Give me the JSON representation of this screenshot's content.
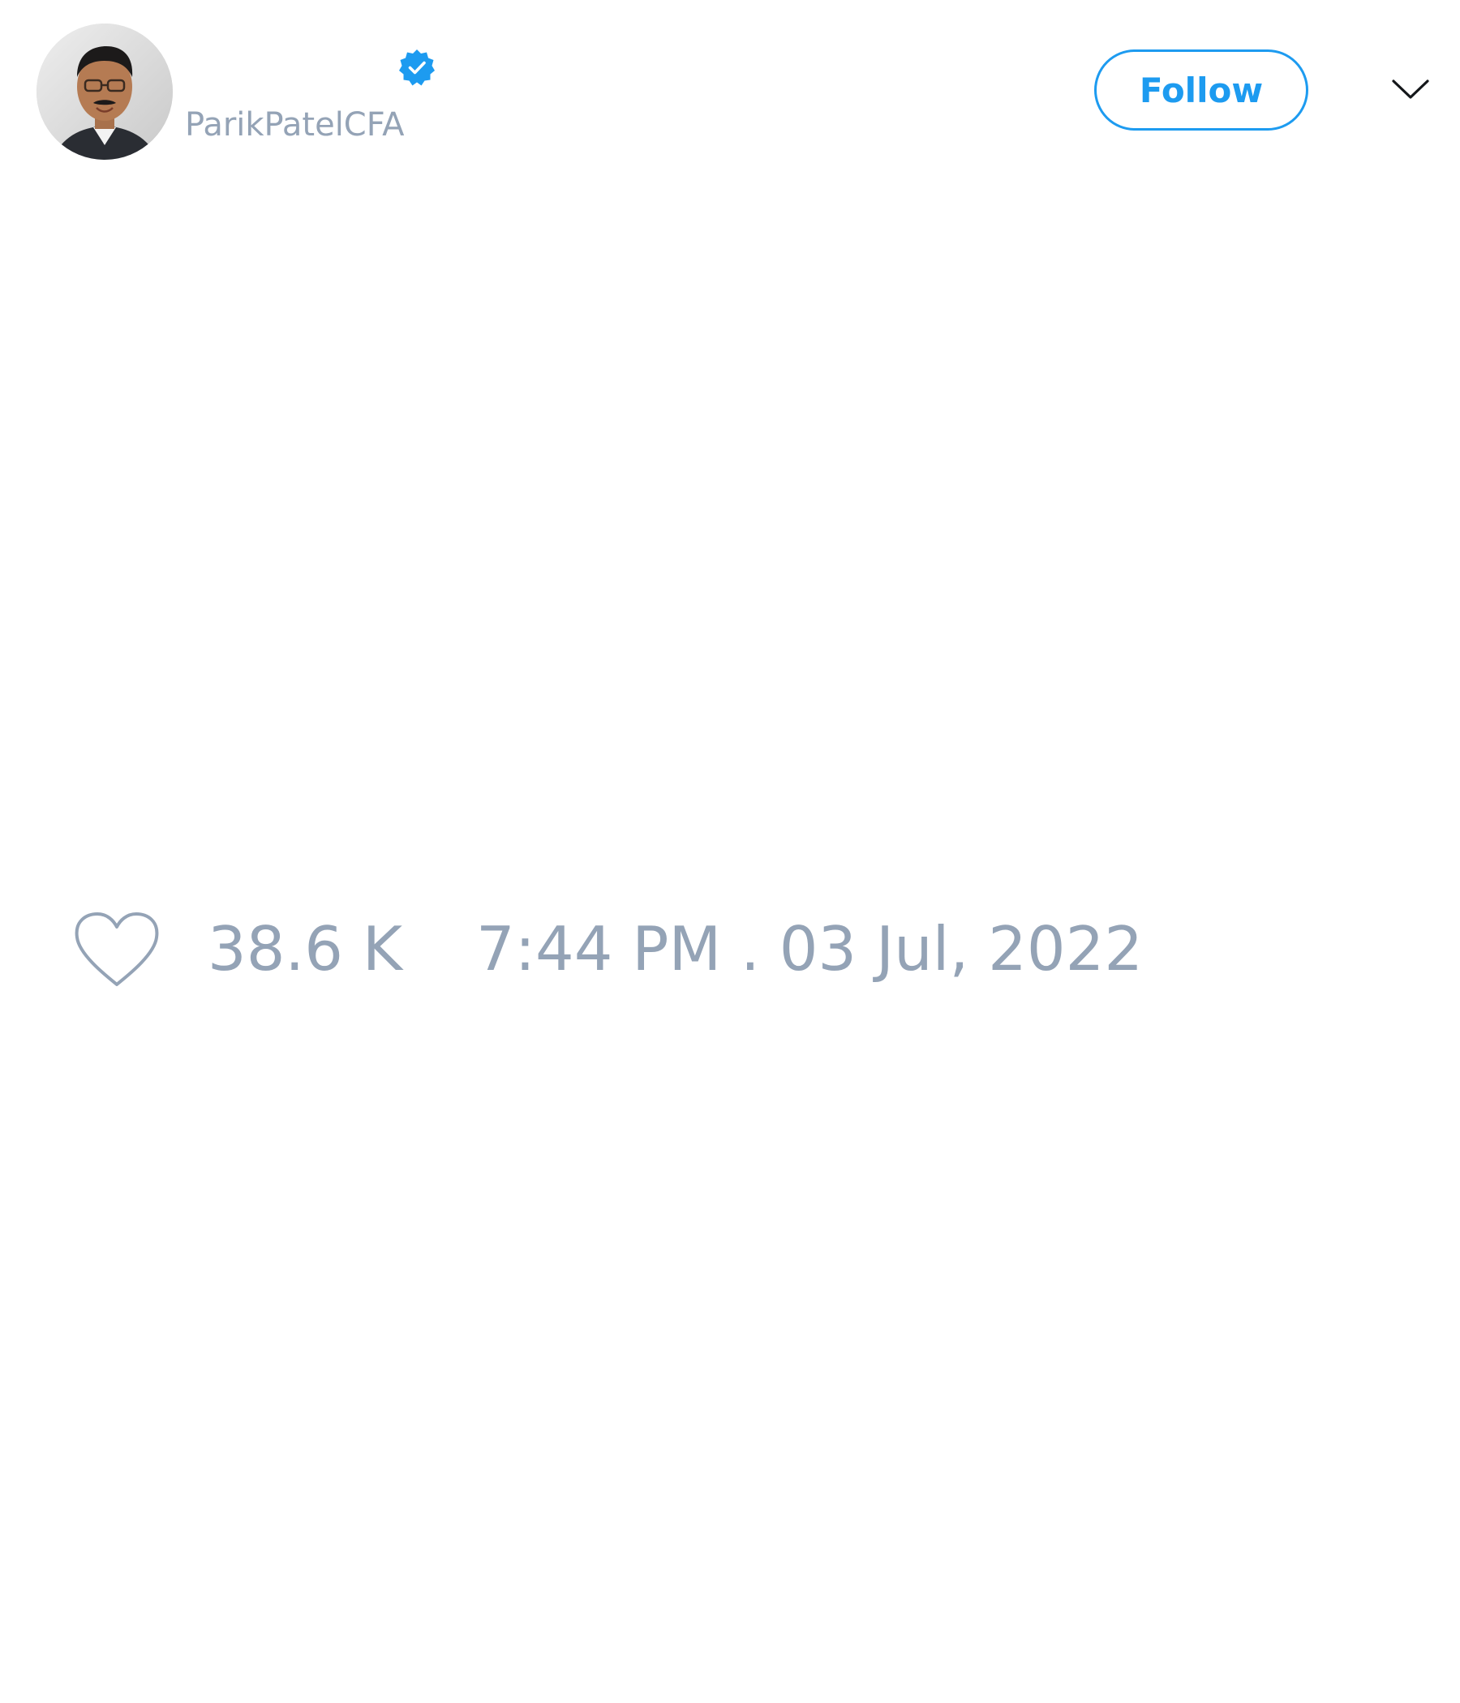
{
  "author": {
    "handle": "ParikPatelCFA",
    "verified": true,
    "avatar_icon": "profile-photo",
    "verified_icon": "verified-badge-icon"
  },
  "actions": {
    "follow_label": "Follow",
    "more_icon": "chevron-down-icon"
  },
  "tweet": {
    "like_icon": "heart-outline-icon",
    "likes": "38.6 K",
    "timestamp": "7:44 PM . 03 Jul, 2022"
  },
  "colors": {
    "accent": "#1d9bf0",
    "muted_text": "#94a3b6",
    "background": "#ffffff",
    "icon_dark": "#14171a"
  }
}
